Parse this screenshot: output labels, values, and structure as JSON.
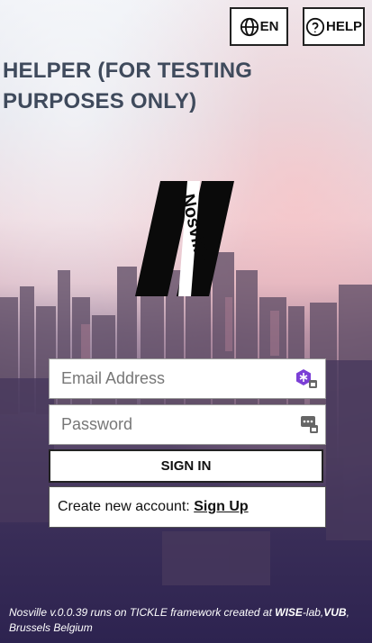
{
  "header": {
    "lang_label": "EN",
    "help_label": "HELP",
    "lang_icon": "globe-icon",
    "help_icon": "question-circle-icon"
  },
  "page": {
    "helper_title": "HELPER (FOR TESTING PURPOSES ONLY)"
  },
  "logo": {
    "text": "Nosville"
  },
  "form": {
    "email_placeholder": "Email Address",
    "email_value": "",
    "password_placeholder": "Password",
    "password_value": "",
    "signin_label": "SIGN IN",
    "create_text": "Create new account:",
    "signup_label": "Sign Up"
  },
  "footer": {
    "part1": "Nosville v.0.0.39 runs on TICKLE framework created at ",
    "org1": "WISE",
    "part2": "-lab,",
    "org2": "VUB",
    "part3": ", Brussels Belgium"
  },
  "colors": {
    "title": "#3f4a5c",
    "button_border": "#222222",
    "autofill_icon": "#7b3fd6"
  }
}
